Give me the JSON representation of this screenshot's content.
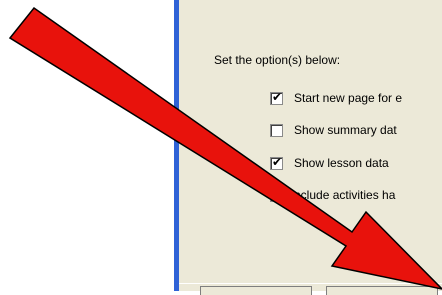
{
  "panel": {
    "prompt": "Set the option(s) below:",
    "options": [
      {
        "label": "Start new page for e",
        "checked": true
      },
      {
        "label": "Show summary dat",
        "checked": false
      },
      {
        "label": "Show lesson data",
        "checked": true
      },
      {
        "label": "nclude activities ha",
        "checked": false
      }
    ]
  },
  "annotation": {
    "icon": "red-arrow-icon",
    "color": "#e8120c"
  }
}
